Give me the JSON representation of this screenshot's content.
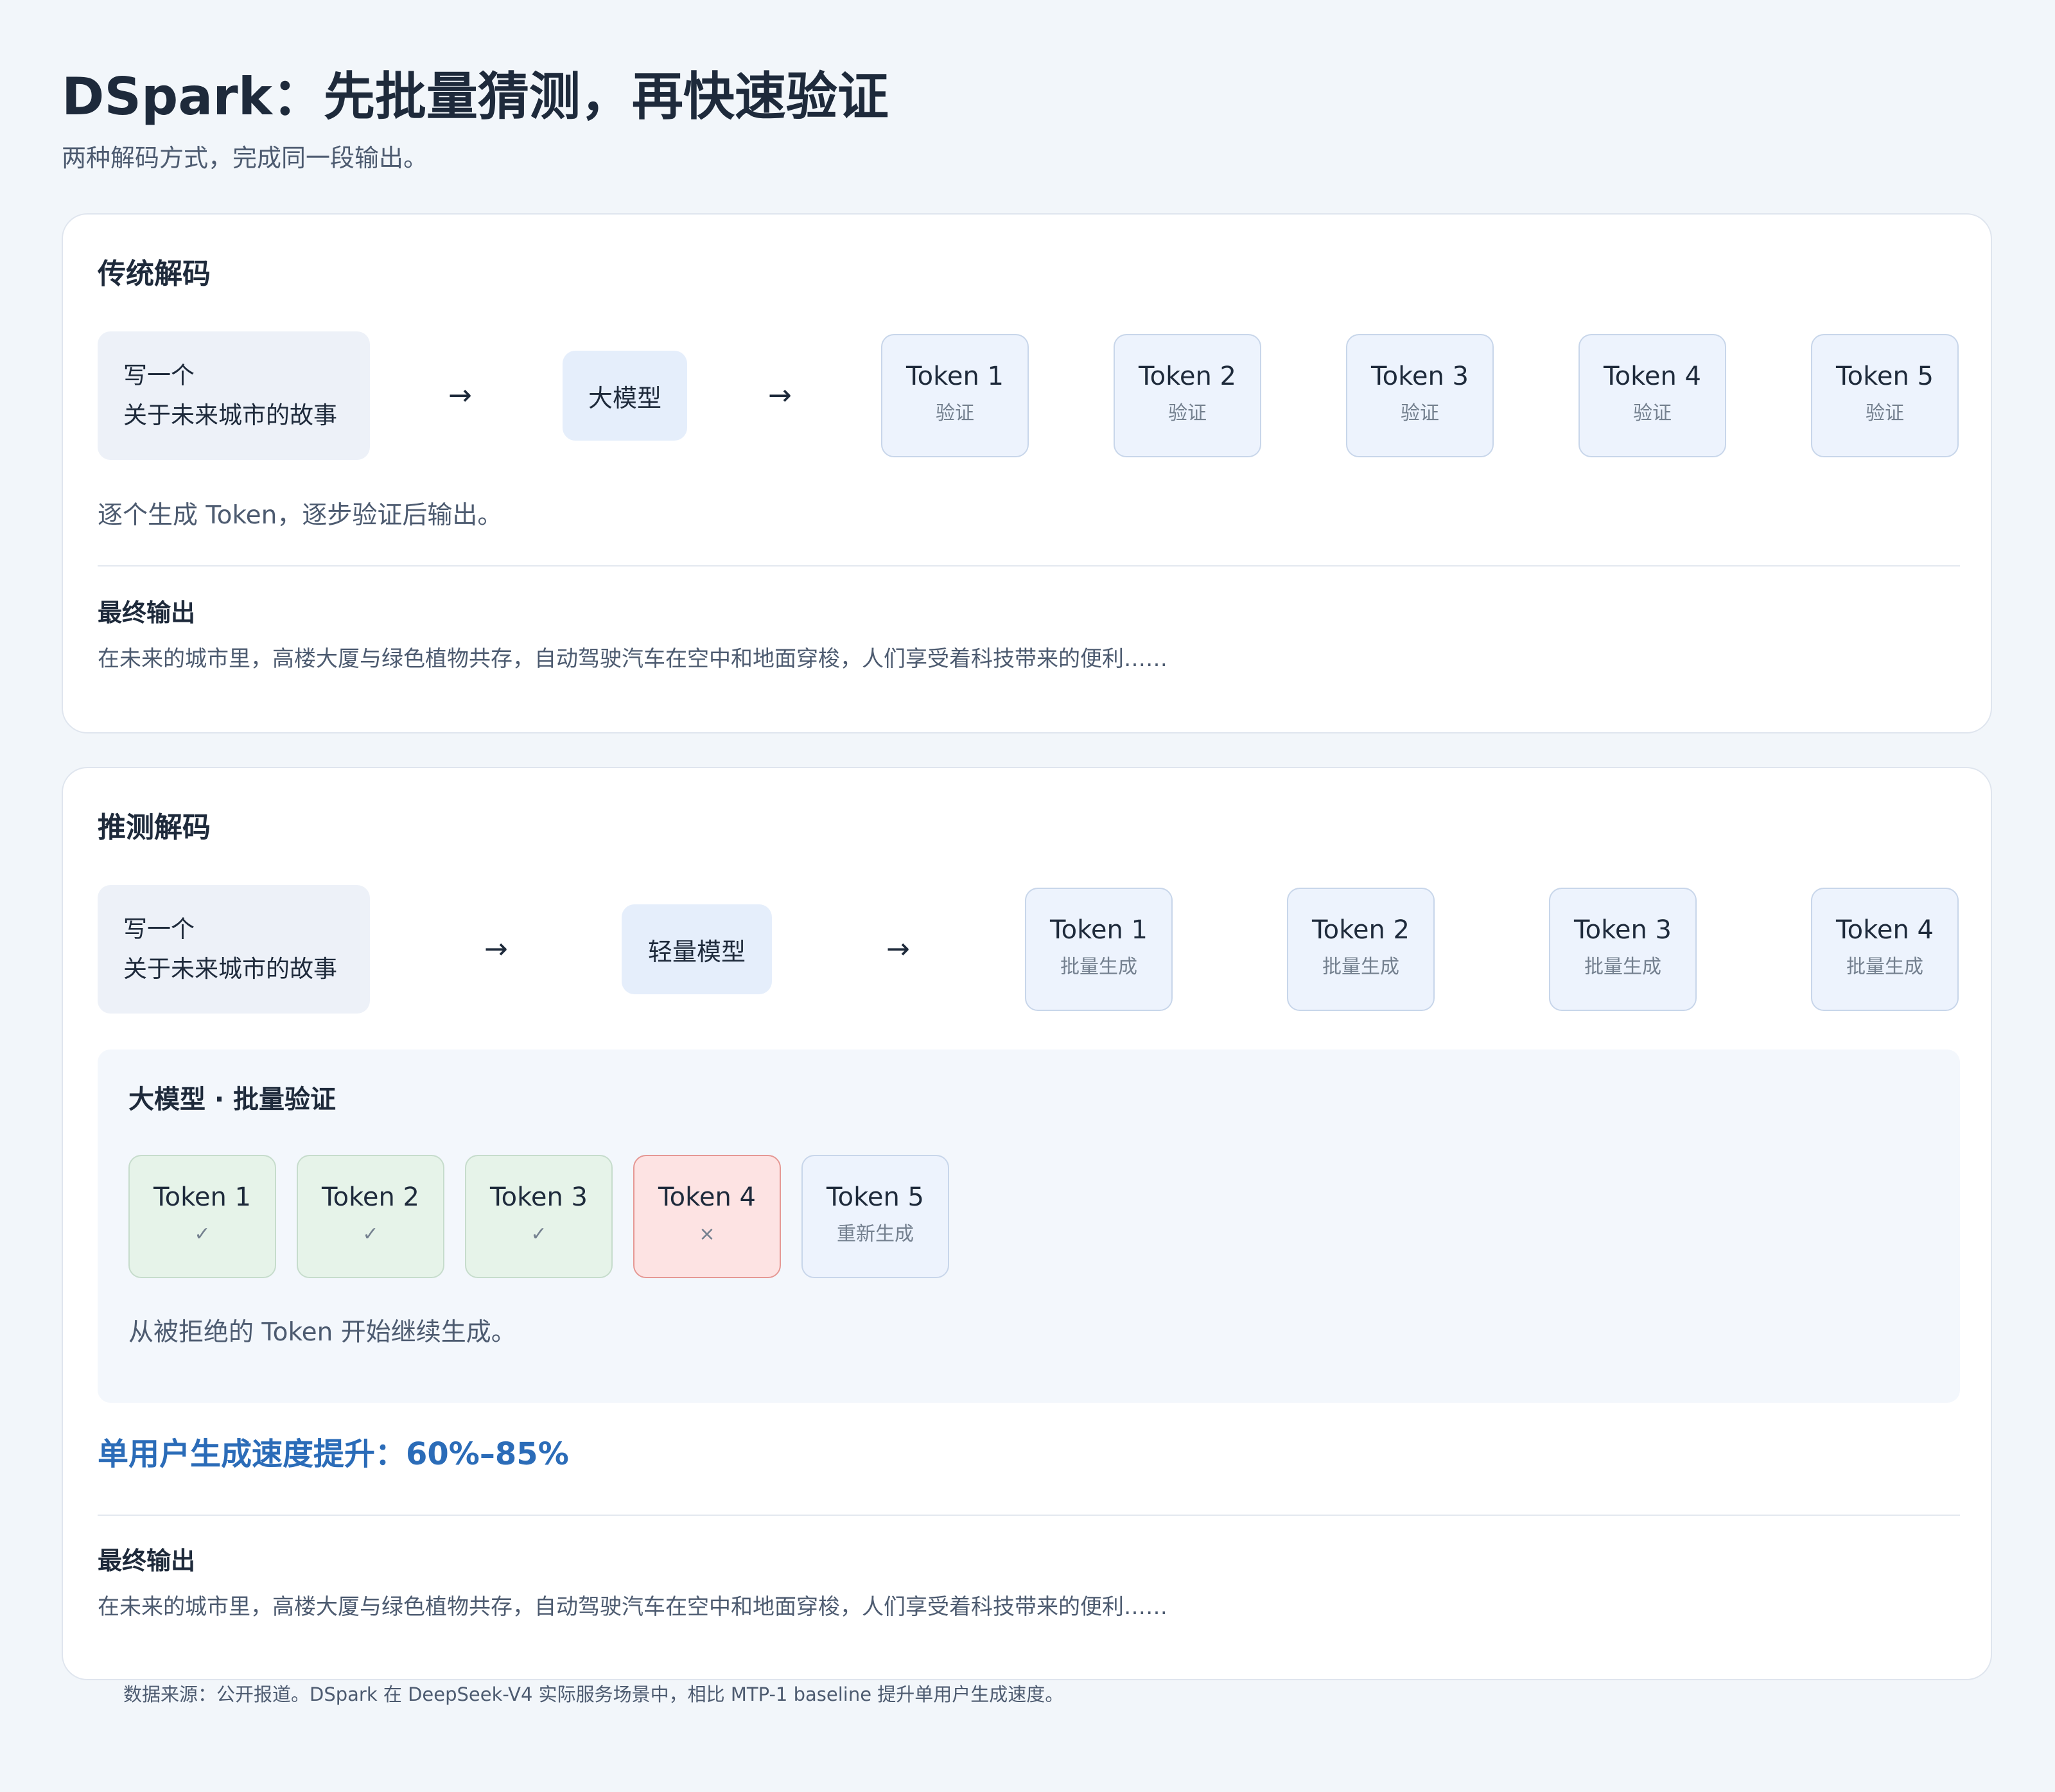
{
  "header": {
    "title": "DSpark：先批量猜测，再快速验证",
    "subtitle": "两种解码方式，完成同一段输出。"
  },
  "traditional": {
    "title": "传统解码",
    "prompt": [
      "写一个",
      "关于未来城市的故事"
    ],
    "arrow": "→",
    "model": "大模型",
    "tokens": [
      {
        "name": "Token 1",
        "sub": "验证"
      },
      {
        "name": "Token 2",
        "sub": "验证"
      },
      {
        "name": "Token 3",
        "sub": "验证"
      },
      {
        "name": "Token 4",
        "sub": "验证"
      },
      {
        "name": "Token 5",
        "sub": "验证"
      }
    ],
    "description": "逐个生成 Token，逐步验证后输出。",
    "output_title": "最终输出",
    "output_text": "在未来的城市里，高楼大厦与绿色植物共存，自动驾驶汽车在空中和地面穿梭，人们享受着科技带来的便利……"
  },
  "speculative": {
    "title": "推测解码",
    "prompt": [
      "写一个",
      "关于未来城市的故事"
    ],
    "arrow": "→",
    "model": "轻量模型",
    "draft_tokens": [
      {
        "name": "Token 1",
        "sub": "批量生成"
      },
      {
        "name": "Token 2",
        "sub": "批量生成"
      },
      {
        "name": "Token 3",
        "sub": "批量生成"
      },
      {
        "name": "Token 4",
        "sub": "批量生成"
      }
    ],
    "verify": {
      "title": "大模型 · 批量验证",
      "tokens": [
        {
          "name": "Token 1",
          "mark": "✓",
          "status": "accepted"
        },
        {
          "name": "Token 2",
          "mark": "✓",
          "status": "accepted"
        },
        {
          "name": "Token 3",
          "mark": "✓",
          "status": "accepted"
        },
        {
          "name": "Token 4",
          "mark": "×",
          "status": "rejected"
        },
        {
          "name": "Token 5",
          "mark": "重新生成",
          "status": "regenerated"
        }
      ],
      "description": "从被拒绝的 Token 开始继续生成。"
    },
    "speedup": "单用户生成速度提升：60%–85%",
    "output_title": "最终输出",
    "output_text": "在未来的城市里，高楼大厦与绿色植物共存，自动驾驶汽车在空中和地面穿梭，人们享受着科技带来的便利……"
  },
  "footnote": "数据来源：公开报道。DSpark 在 DeepSeek-V4 实际服务场景中，相比 MTP-1 baseline 提升单用户生成速度。",
  "colors": {
    "background": "#f2f6fa",
    "accent_blue": "#2b6cb8",
    "accepted_green": "#e6f3e9",
    "rejected_red": "#fde3e3",
    "rejected_border": "#e59894",
    "token_blue": "#edf3fd"
  }
}
